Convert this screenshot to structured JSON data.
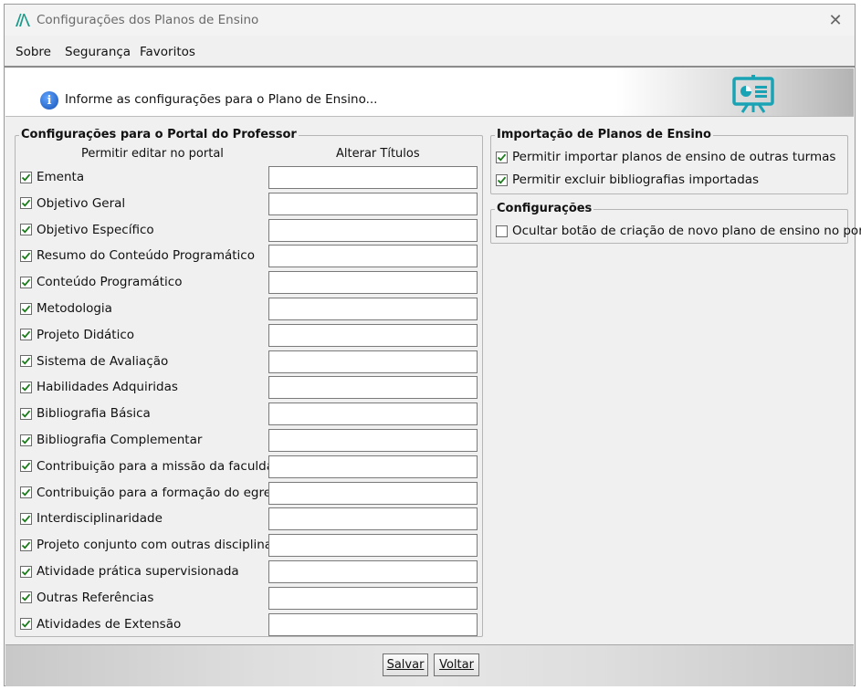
{
  "window": {
    "title": "Configurações dos Planos de Ensino",
    "close_glyph": "✕"
  },
  "menu": [
    {
      "label": "Sobre"
    },
    {
      "label": "Segurança"
    },
    {
      "label": "Favoritos"
    }
  ],
  "banner": {
    "info_glyph": "i",
    "text": "Informe as configurações para o Plano de Ensino..."
  },
  "portal": {
    "title": "Configurações para o Portal do Professor",
    "col_edit": "Permitir editar no portal",
    "col_titles": "Alterar Títulos",
    "items": [
      {
        "label": "Ementa",
        "checked": true,
        "title_value": ""
      },
      {
        "label": "Objetivo Geral",
        "checked": true,
        "title_value": ""
      },
      {
        "label": "Objetivo Específico",
        "checked": true,
        "title_value": ""
      },
      {
        "label": "Resumo do Conteúdo Programático",
        "checked": true,
        "title_value": ""
      },
      {
        "label": "Conteúdo Programático",
        "checked": true,
        "title_value": ""
      },
      {
        "label": "Metodologia",
        "checked": true,
        "title_value": ""
      },
      {
        "label": "Projeto Didático",
        "checked": true,
        "title_value": ""
      },
      {
        "label": "Sistema de Avaliação",
        "checked": true,
        "title_value": ""
      },
      {
        "label": "Habilidades Adquiridas",
        "checked": true,
        "title_value": ""
      },
      {
        "label": "Bibliografia Básica",
        "checked": true,
        "title_value": ""
      },
      {
        "label": "Bibliografia Complementar",
        "checked": true,
        "title_value": ""
      },
      {
        "label": "Contribuição para a missão da faculdade",
        "checked": true,
        "title_value": ""
      },
      {
        "label": "Contribuição para a formação do egresso",
        "checked": true,
        "title_value": ""
      },
      {
        "label": "Interdisciplinaridade",
        "checked": true,
        "title_value": ""
      },
      {
        "label": "Projeto conjunto com outras disciplinas",
        "checked": true,
        "title_value": ""
      },
      {
        "label": "Atividade prática supervisionada",
        "checked": true,
        "title_value": ""
      },
      {
        "label": "Outras Referências",
        "checked": true,
        "title_value": ""
      },
      {
        "label": "Atividades de Extensão",
        "checked": true,
        "title_value": ""
      }
    ]
  },
  "import": {
    "title": "Importação de Planos de Ensino",
    "items": [
      {
        "label": "Permitir importar planos de ensino de outras turmas",
        "checked": true
      },
      {
        "label": "Permitir excluir bibliografias importadas",
        "checked": true
      }
    ]
  },
  "config": {
    "title": "Configurações",
    "items": [
      {
        "label": "Ocultar botão de criação de novo plano de ensino no portal",
        "checked": false
      }
    ]
  },
  "buttons": {
    "save": "Salvar",
    "back": "Voltar"
  },
  "colors": {
    "check": "#1a7a1a",
    "logo": "#1a9a8a",
    "board": "#1aa3b5",
    "info": "#1551b5"
  }
}
